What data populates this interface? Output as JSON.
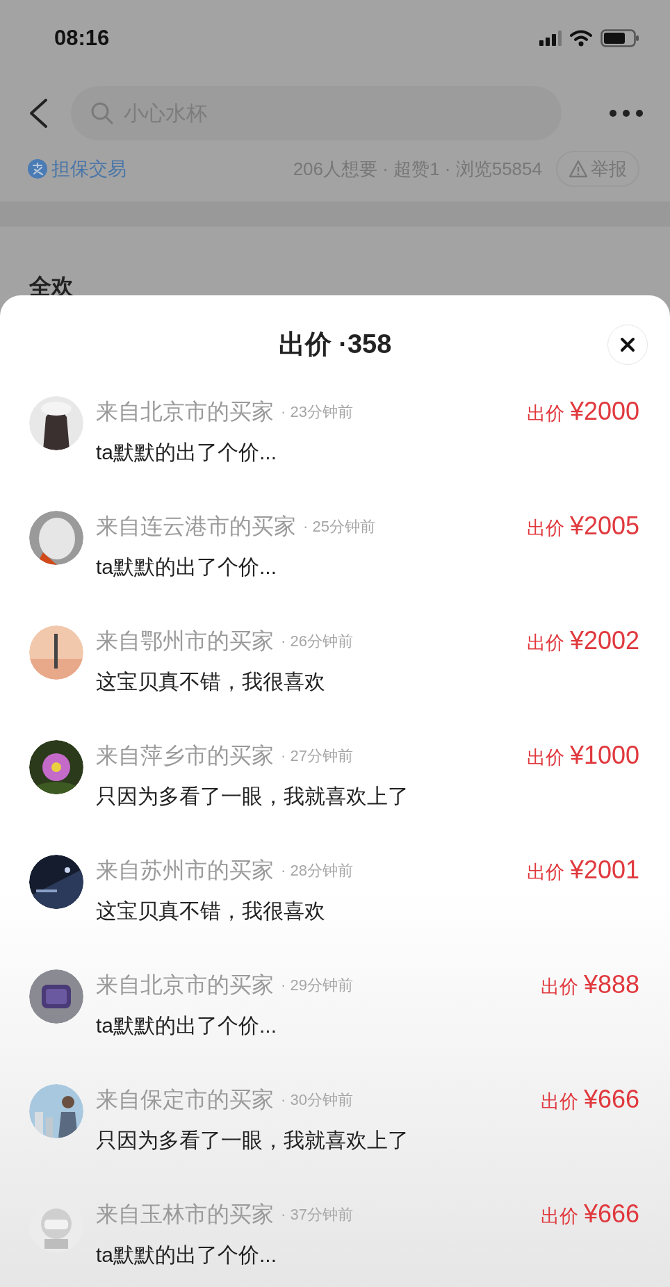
{
  "status_bar": {
    "time": "08:16"
  },
  "nav": {
    "search_placeholder": "小心水杯"
  },
  "info": {
    "guarantee": "担保交易",
    "stats": "206人想要 · 超赞1 · 浏览55854",
    "report": "举报"
  },
  "section_heading": "全欢",
  "sheet": {
    "title": "出价 ·358",
    "bids": [
      {
        "buyer": "来自北京市的买家",
        "time": "· 23分钟前",
        "comment": "ta默默的出了个价...",
        "price_label": "出价",
        "price": "¥2000"
      },
      {
        "buyer": "来自连云港市的买家",
        "time": "· 25分钟前",
        "comment": "ta默默的出了个价...",
        "price_label": "出价",
        "price": "¥2005"
      },
      {
        "buyer": "来自鄂州市的买家",
        "time": "· 26分钟前",
        "comment": "这宝贝真不错，我很喜欢",
        "price_label": "出价",
        "price": "¥2002"
      },
      {
        "buyer": "来自萍乡市的买家",
        "time": "· 27分钟前",
        "comment": "只因为多看了一眼，我就喜欢上了",
        "price_label": "出价",
        "price": "¥1000"
      },
      {
        "buyer": "来自苏州市的买家",
        "time": "· 28分钟前",
        "comment": "这宝贝真不错，我很喜欢",
        "price_label": "出价",
        "price": "¥2001"
      },
      {
        "buyer": "来自北京市的买家",
        "time": "· 29分钟前",
        "comment": "ta默默的出了个价...",
        "price_label": "出价",
        "price": "¥888"
      },
      {
        "buyer": "来自保定市的买家",
        "time": "· 30分钟前",
        "comment": "只因为多看了一眼，我就喜欢上了",
        "price_label": "出价",
        "price": "¥666"
      },
      {
        "buyer": "来自玉林市的买家",
        "time": "· 37分钟前",
        "comment": "ta默默的出了个价...",
        "price_label": "出价",
        "price": "¥666"
      }
    ]
  }
}
